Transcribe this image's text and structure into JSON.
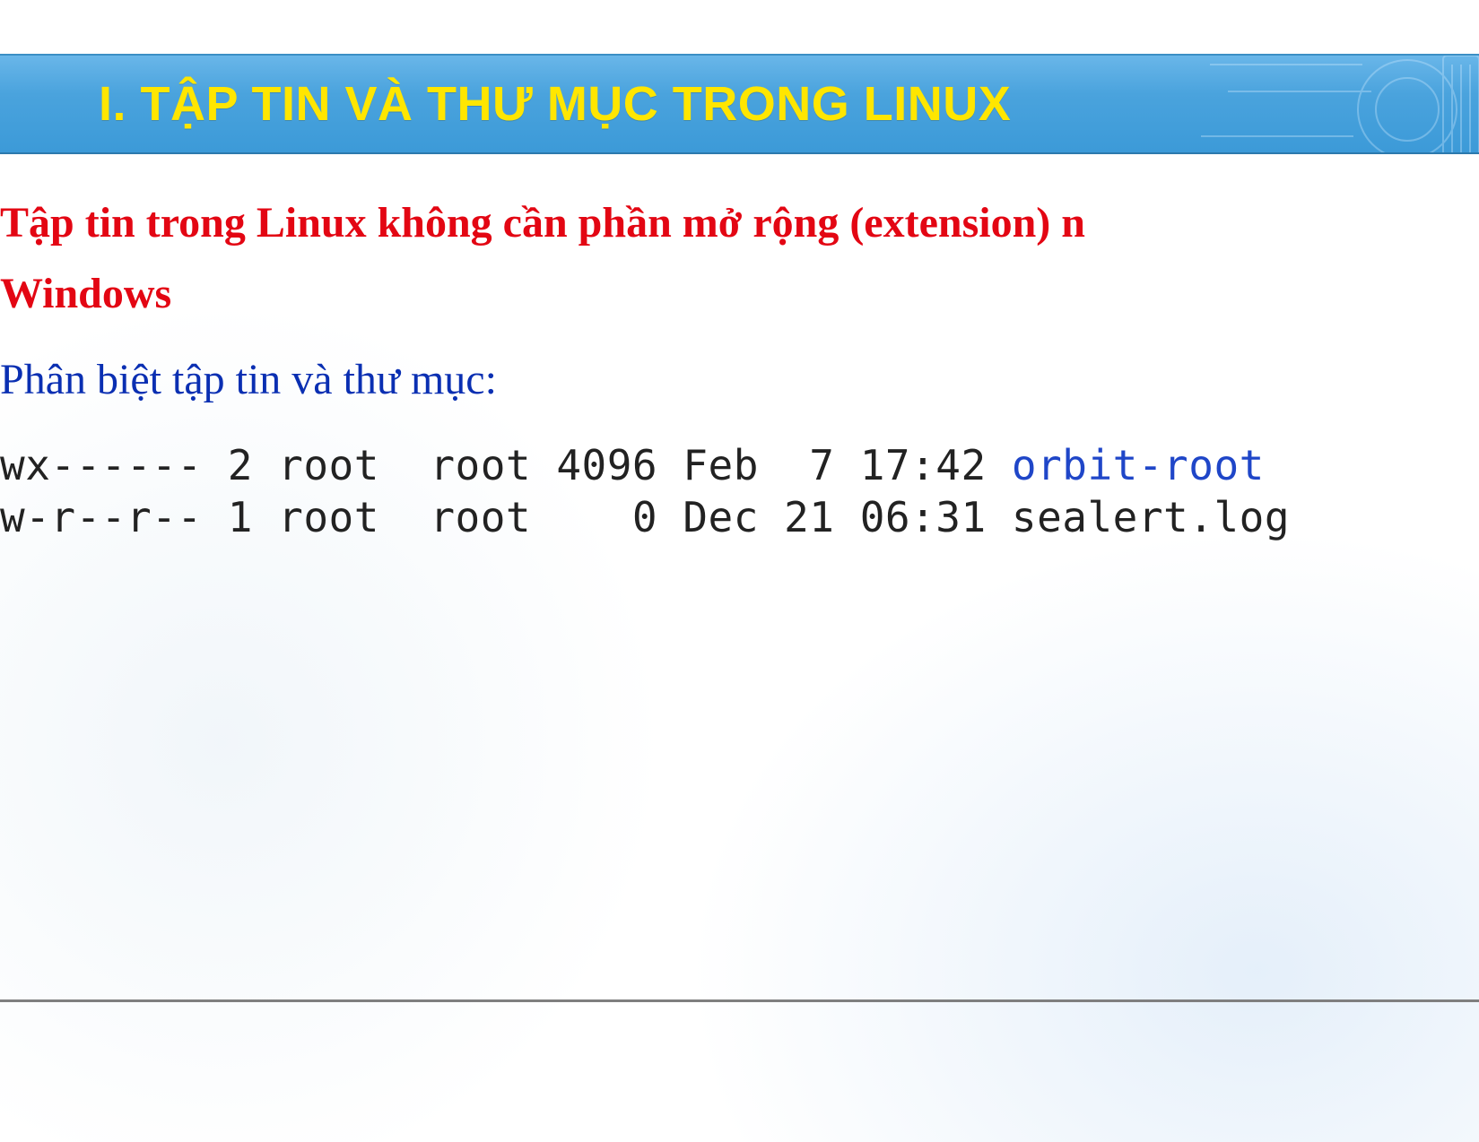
{
  "header": {
    "title": "I. TẬP TIN VÀ THƯ MỤC TRONG LINUX"
  },
  "body": {
    "red_line_1": "Tập tin trong Linux không cần phần mở rộng (extension) n",
    "red_line_2": "Windows",
    "blue_line": "Phân biệt tập tin và thư mục:"
  },
  "terminal": {
    "rows": [
      {
        "perm_tail": "wx------",
        "links": "2",
        "owner": "root",
        "group": "root",
        "size": "4096",
        "month": "Feb",
        "day": "7",
        "time": "17:42",
        "name": "orbit-root",
        "is_dir": true
      },
      {
        "perm_tail": "w-r--r--",
        "links": "1",
        "owner": "root",
        "group": "root",
        "size": "0",
        "month": "Dec",
        "day": "21",
        "time": "06:31",
        "name": "sealert.log",
        "is_dir": false
      }
    ]
  }
}
